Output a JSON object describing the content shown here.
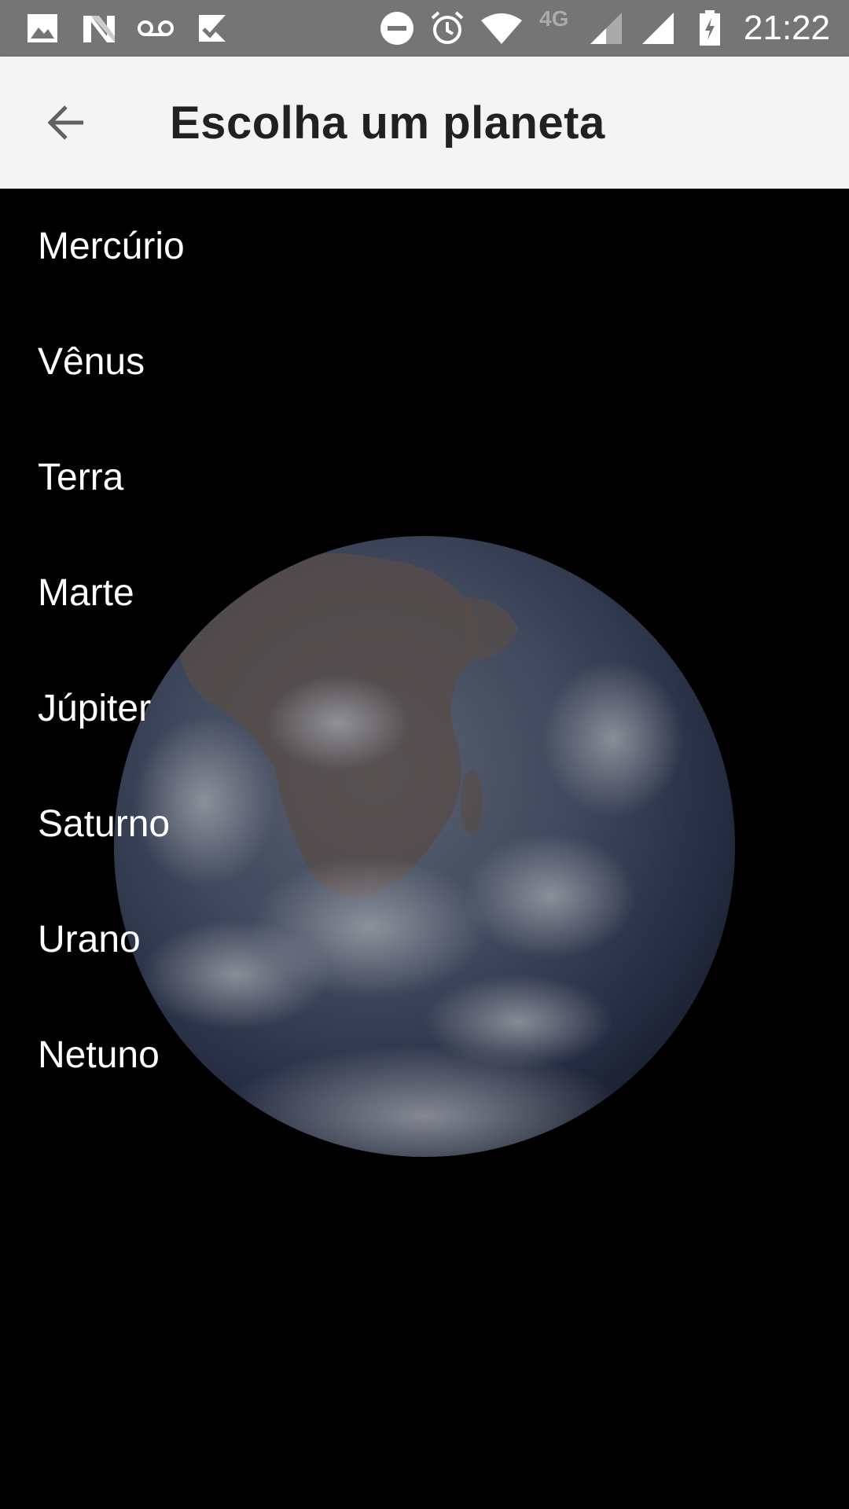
{
  "status_bar": {
    "time": "21:22",
    "network_type": "4G",
    "icons": [
      "image-icon",
      "n-icon",
      "voicemail-icon",
      "check-app-icon",
      "do-not-disturb-icon",
      "alarm-icon",
      "wifi-icon",
      "signal-icon",
      "signal-icon",
      "battery-charging-icon"
    ]
  },
  "app_bar": {
    "title": "Escolha um planeta",
    "back_icon": "arrow-back-icon"
  },
  "planets": [
    {
      "label": "Mercúrio"
    },
    {
      "label": "Vênus"
    },
    {
      "label": "Terra"
    },
    {
      "label": "Marte"
    },
    {
      "label": "Júpiter"
    },
    {
      "label": "Saturno"
    },
    {
      "label": "Urano"
    },
    {
      "label": "Netuno"
    }
  ],
  "background": {
    "image": "earth-image"
  },
  "colors": {
    "status_bar": "#757575",
    "app_bar": "#f4f4f4",
    "title_text": "#212121",
    "list_text": "#ffffff",
    "background": "#000000"
  }
}
